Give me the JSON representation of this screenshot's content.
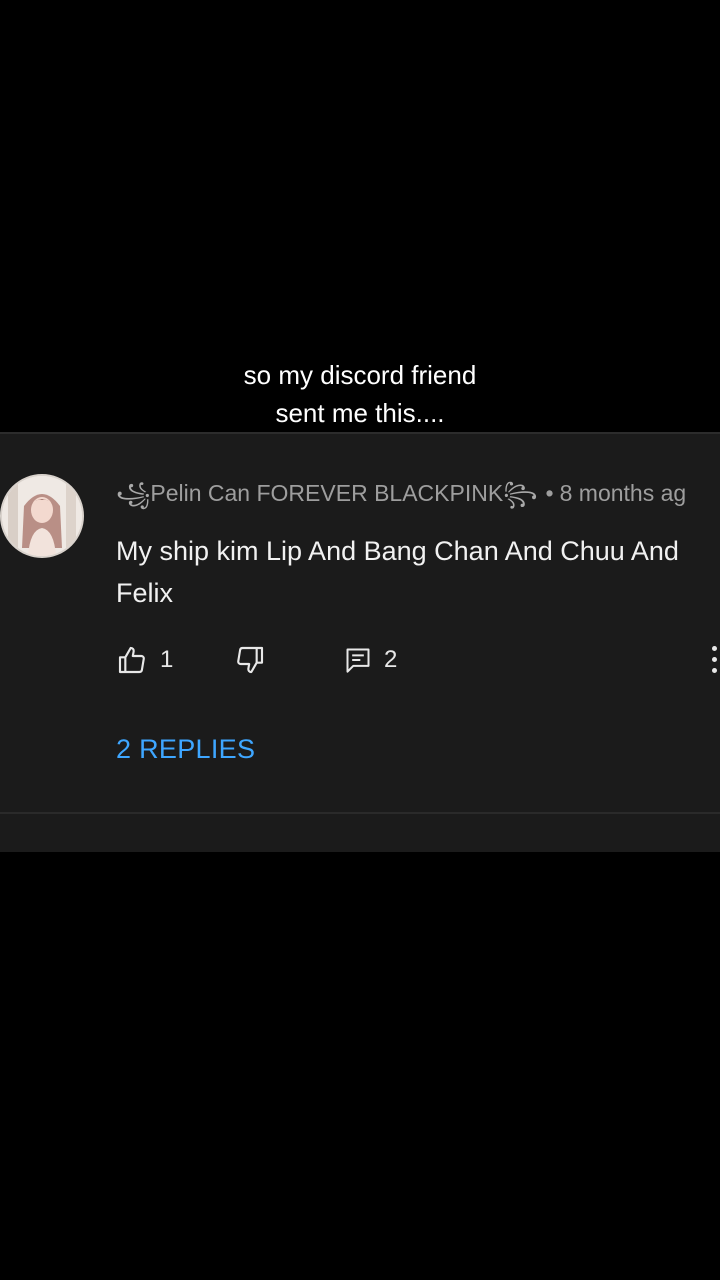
{
  "caption": {
    "line1": "so my discord friend",
    "line2": "sent me this...."
  },
  "comment": {
    "flourish_left": "꧁",
    "author": "Pelin Can FOREVER BLACKPINK",
    "flourish_right": "꧂",
    "separator": "•",
    "timestamp": "8 months ag",
    "text": "My ship kim Lip And Bang Chan And Chuu And Felix",
    "like_count": "1",
    "reply_count": "2",
    "replies_link": "2 REPLIES",
    "icons": {
      "like": "thumbs-up-icon",
      "dislike": "thumbs-down-icon",
      "reply": "comment-icon",
      "more": "more-vert-icon",
      "avatar": "avatar"
    },
    "colors": {
      "background": "#1b1b1b",
      "link": "#3ea6ff",
      "meta": "#9e9e9e",
      "text": "#f1f1f1"
    }
  }
}
